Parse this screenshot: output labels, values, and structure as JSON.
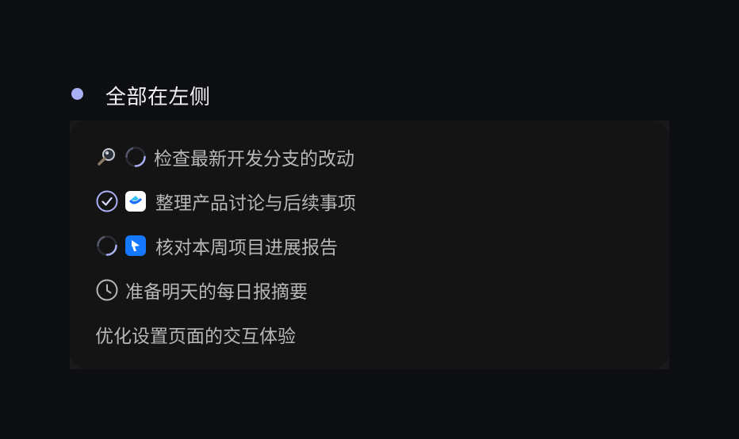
{
  "header": {
    "title": "全部在左侧"
  },
  "tasks": [
    {
      "label": "检查最新开发分支的改动",
      "status": "loading",
      "status_icon": "magnifier-icon",
      "app_icon": "spinner-icon"
    },
    {
      "label": "整理产品讨论与后续事项",
      "status": "done",
      "status_icon": "check-circle-icon",
      "app_icon": "docs-app-icon"
    },
    {
      "label": "核对本周项目进展报告",
      "status": "loading",
      "status_icon": "spinner-icon",
      "app_icon": "feishu-app-icon"
    },
    {
      "label": "准备明天的每日报摘要",
      "status": "scheduled",
      "status_icon": "clock-icon"
    },
    {
      "label": "优化设置页面的交互体验",
      "status": "none"
    }
  ],
  "colors": {
    "accent": "#aab0f5",
    "background": "#0e0f13",
    "panel": "#141414",
    "text": "#b7b7ba",
    "heading": "#f2f2f4"
  }
}
